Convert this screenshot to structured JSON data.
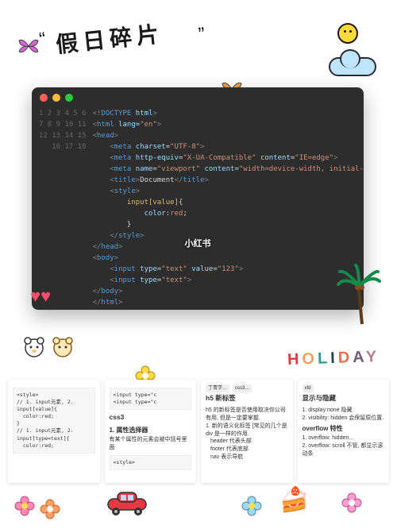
{
  "header": {
    "title": "假日碎片",
    "holiday": [
      "H",
      "O",
      "L",
      "I",
      "D",
      "A",
      "Y"
    ]
  },
  "editor": {
    "watermark": "小红书",
    "traffic": [
      "red",
      "yellow",
      "green"
    ],
    "lines": [
      "1",
      "2",
      "3",
      "4",
      "5",
      "6",
      "7",
      "8",
      "9",
      "10",
      "11",
      "12",
      "13",
      "14",
      "15",
      "16",
      "17",
      "18"
    ],
    "code": {
      "doctype": "<!DOCTYPE html>",
      "html_open": "<html lang=\"en\">",
      "head_open": "<head>",
      "meta1": "<meta charset=\"UTF-8\">",
      "meta2": "<meta http-equiv=\"X-UA-Compatible\" content=\"IE=edge\">",
      "meta3": "<meta name=\"viewport\" content=\"width=device-width, initial-",
      "title": "<title>Document</title>",
      "style_open": "<style>",
      "sel": "input[value]{",
      "decl": "color:red;",
      "brace_close": "}",
      "style_close": "</style>",
      "head_close": "</head>",
      "body_open": "<body>",
      "input1": "<input type=\"text\" value=\"123\">",
      "input2": "<input type=\"text\">",
      "body_close": "</body>",
      "html_close": "</html>"
    }
  },
  "notes": {
    "n1": {
      "style_open": "<style>",
      "c1": "// 1. input元素, 2.",
      "c2": "input[value]{",
      "c3": "  color:red;",
      "c4": "}",
      "c5": "// 1. input元素, 2.",
      "c6": "input[type=text]{",
      "c7": "  color:red;"
    },
    "n2": {
      "snippet1": "<input type=\"c",
      "snippet2": "<input type=\"c",
      "h_css3": "css3",
      "h_attr": "1. 属性选择器",
      "desc": "有某个属性的元素会被中括号里面",
      "style_open": "<style>"
    },
    "n3": {
      "tab1": "丁青学…",
      "tab2": "css3…",
      "h_h5": "h5 新标签",
      "line1": "h5 的新标签是否使用取决你公司有用, 但是一定要掌握.",
      "bullet1": "1. 新的语义化标签 [常见的几个是 div 是一样的作用.",
      "b1": "header 代表头部",
      "b2": "footer 代表底部",
      "b3": "nav 表示导航"
    },
    "n4": {
      "tab": "xfd",
      "h": "显示与隐藏",
      "l1": "1. display:none 隐藏",
      "l2": "2. visibility: hidden 会保留原位置.",
      "h2": "overflow 特性",
      "l3": "1. overflow: hidden…",
      "l4": "2. overflow: scroll 不管, 都显示滚动条"
    }
  }
}
